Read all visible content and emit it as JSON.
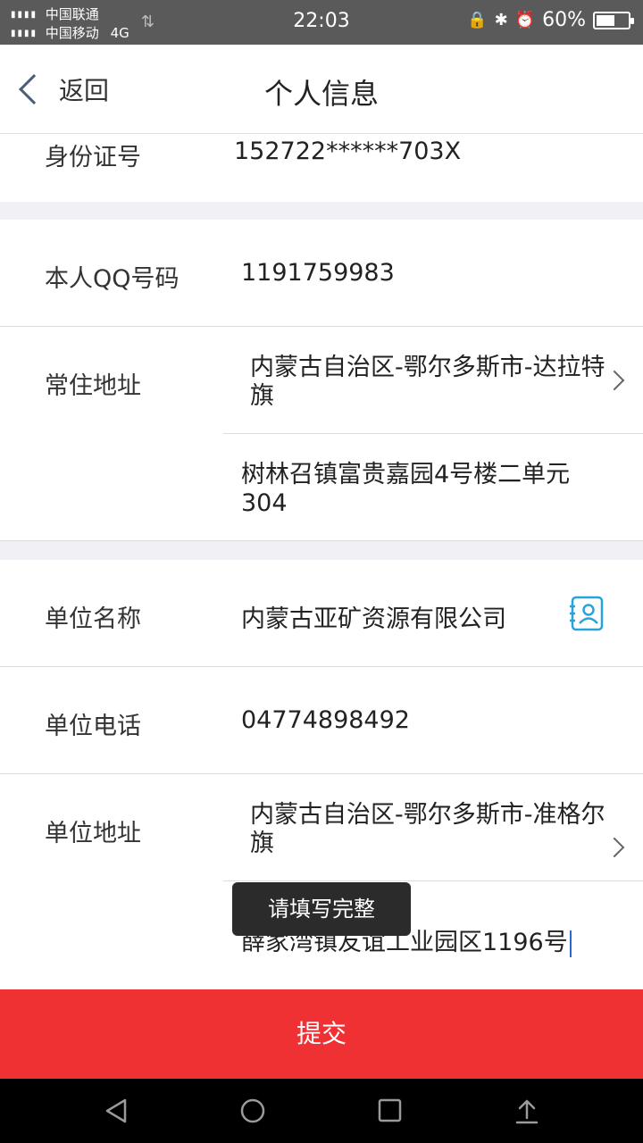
{
  "status_bar": {
    "carrier_1": "中国联通",
    "carrier_2": "中国移动",
    "network_type": "4G",
    "time": "22:03",
    "battery_percent": "60%",
    "battery_level": 0.6,
    "icons": [
      "lock-rotation-icon",
      "bluetooth-icon",
      "alarm-icon",
      "battery-icon"
    ]
  },
  "nav": {
    "back_label": "返回",
    "title": "个人信息"
  },
  "form": {
    "id_number": {
      "label": "身份证号",
      "value": "152722******703X"
    },
    "qq": {
      "label": "本人QQ号码",
      "value": "1191759983"
    },
    "home_address": {
      "label": "常住地址",
      "region": "内蒙古自治区-鄂尔多斯市-达拉特旗",
      "detail": "树林召镇富贵嘉园4号楼二单元304"
    },
    "company_name": {
      "label": "单位名称",
      "value": "内蒙古亚矿资源有限公司"
    },
    "company_phone": {
      "label": "单位电话",
      "value": "04774898492"
    },
    "company_address": {
      "label": "单位地址",
      "region": "内蒙古自治区-鄂尔多斯市-准格尔旗",
      "detail": "薛家湾镇友谊工业园区1196号"
    }
  },
  "toast": {
    "message": "请填写完整"
  },
  "submit": {
    "label": "提交"
  },
  "colors": {
    "accent_red": "#ef3133",
    "icon_blue": "#29a3dc",
    "status_bar_bg": "#5a5a5a"
  }
}
